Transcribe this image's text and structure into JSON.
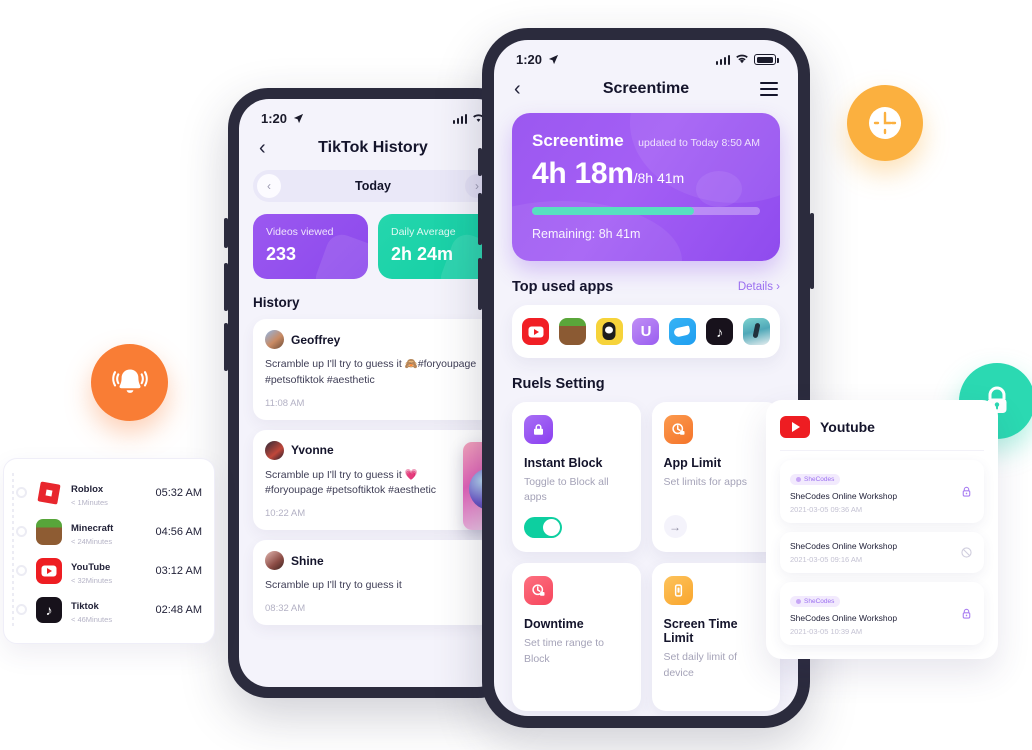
{
  "phone_left": {
    "status": {
      "time": "1:20",
      "location_icon": "location-arrow-icon"
    },
    "nav": {
      "back_icon": "chevron-left-icon",
      "title": "TikTok History"
    },
    "daypicker": {
      "prev_icon": "chevron-left-icon",
      "label": "Today",
      "next_icon": "chevron-right-icon"
    },
    "stats": [
      {
        "label": "Videos viewed",
        "value": "233",
        "color": "#9b58f0"
      },
      {
        "label": "Daily Average",
        "value": "2h 24m",
        "color": "#12cfa4"
      }
    ],
    "history_title": "History",
    "posts": [
      {
        "name": "Geoffrey",
        "text": "Scramble up I'll try to guess it 🙈#foryoupage #petsoftiktok #aesthetic",
        "time": "11:08 AM",
        "has_thumb": false
      },
      {
        "name": "Yvonne",
        "text": "Scramble up I'll try to guess it 💗 #foryoupage #petsoftiktok #aesthetic",
        "time": "10:22 AM",
        "has_thumb": true
      },
      {
        "name": "Shine",
        "text": "Scramble up I'll try to guess it",
        "time": "08:32 AM",
        "has_thumb": false
      }
    ]
  },
  "phone_main": {
    "status": {
      "time": "1:20",
      "location_icon": "location-arrow-icon",
      "signal_icon": "cellular-signal-icon",
      "wifi_icon": "wifi-icon",
      "battery_icon": "battery-icon"
    },
    "nav": {
      "back_icon": "chevron-left-icon",
      "title": "Screentime",
      "menu_icon": "hamburger-menu-icon"
    },
    "hero": {
      "title": "Screentime",
      "updated": "updated to Today 8:50 AM",
      "used": "4h 18m",
      "total": "/8h 41m",
      "progress_percent": 71,
      "remaining": "Remaining: 8h 41m",
      "bg_color": "#9b58f0",
      "bar_color": "#57e0c0"
    },
    "top_apps": {
      "title": "Top used apps",
      "details_label": "Details",
      "details_icon": "chevron-right-icon",
      "apps": [
        "youtube-icon",
        "minecraft-icon",
        "qq-penguin-icon",
        "u-app-icon",
        "wechat-bird-icon",
        "tiktok-icon",
        "photo-app-icon"
      ]
    },
    "rules": {
      "title": "Ruels Setting",
      "cards": [
        {
          "icon": "lock-shield-icon",
          "icon_color": "#8b4ff0",
          "name": "Instant Block",
          "desc": "Toggle to Block all apps",
          "control": "toggle",
          "toggle_on": true
        },
        {
          "icon": "app-limit-icon",
          "icon_color": "#f98033",
          "name": "App Limit",
          "desc": "Set limits for apps",
          "control": "arrow"
        },
        {
          "icon": "clock-lock-icon",
          "icon_color": "#f9566a",
          "name": "Downtime",
          "desc": "Set time range to Block",
          "control": "none"
        },
        {
          "icon": "device-limit-icon",
          "icon_color": "#fbb03f",
          "name": "Screen Time Limit",
          "desc": "Set daily limit of device",
          "control": "none"
        }
      ]
    }
  },
  "badges": [
    {
      "name": "clock-badge",
      "icon": "clock-icon",
      "color": "#fbb03f"
    },
    {
      "name": "bell-badge",
      "icon": "bell-ringing-icon",
      "color": "#f97d35"
    },
    {
      "name": "lock-badge",
      "icon": "lock-icon",
      "color": "#2bd9b2"
    }
  ],
  "app_list": {
    "rows": [
      {
        "icon": "roblox-icon",
        "name": "Roblox",
        "duration": "< 1Minutes",
        "time": "05:32 AM"
      },
      {
        "icon": "minecraft-icon",
        "name": "Minecraft",
        "duration": "< 24Minutes",
        "time": "04:56 AM"
      },
      {
        "icon": "youtube-icon",
        "name": "YouTube",
        "duration": "< 32Minutes",
        "time": "03:12 AM"
      },
      {
        "icon": "tiktok-icon",
        "name": "Tiktok",
        "duration": "< 46Minutes",
        "time": "02:48 AM"
      }
    ]
  },
  "youtube_card": {
    "logo_icon": "youtube-icon",
    "title": "Youtube",
    "items": [
      {
        "tag": "SheCodes",
        "has_tag": true,
        "name": "SheCodes Online Workshop",
        "date": "2021-03-05 09:36 AM",
        "action_icon": "lock-icon"
      },
      {
        "tag": "",
        "has_tag": false,
        "name": "SheCodes Online Workshop",
        "date": "2021-03-05 09:16 AM",
        "action_icon": "block-icon"
      },
      {
        "tag": "SheCodes",
        "has_tag": true,
        "name": "SheCodes Online Workshop",
        "date": "2021-03-05 10:39 AM",
        "action_icon": "lock-icon"
      }
    ]
  }
}
